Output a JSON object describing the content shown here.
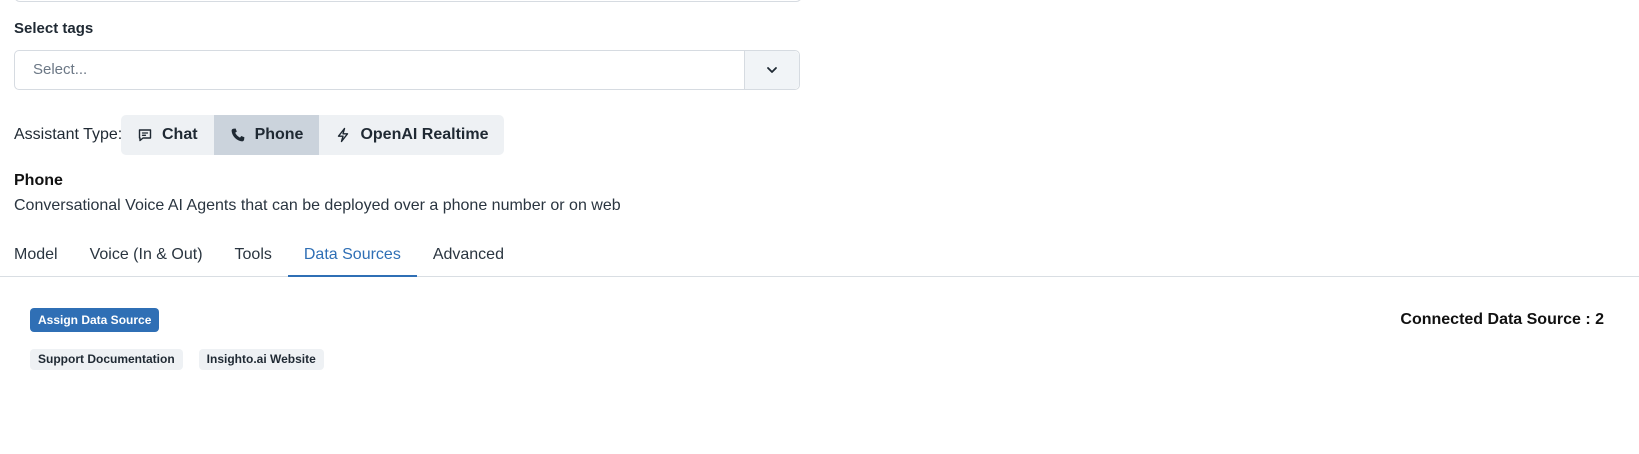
{
  "tags": {
    "label": "Select tags",
    "placeholder": "Select..."
  },
  "assistant_type": {
    "label": "Assistant Type:",
    "options": [
      {
        "label": "Chat",
        "icon": "chat-icon",
        "selected": false
      },
      {
        "label": "Phone",
        "icon": "phone-icon",
        "selected": true
      },
      {
        "label": "OpenAI Realtime",
        "icon": "lightning-icon",
        "selected": false
      }
    ],
    "title": "Phone",
    "description": "Conversational Voice AI Agents that can be deployed over a phone number or on web"
  },
  "tabs": [
    {
      "label": "Model",
      "active": false
    },
    {
      "label": "Voice (In & Out)",
      "active": false
    },
    {
      "label": "Tools",
      "active": false
    },
    {
      "label": "Data Sources",
      "active": true
    },
    {
      "label": "Advanced",
      "active": false
    }
  ],
  "data_sources": {
    "assign_label": "Assign Data Source",
    "connected_label": "Connected Data Source : 2",
    "items": [
      "Support Documentation",
      "Insighto.ai Website"
    ]
  },
  "colors": {
    "accent": "#2f6fb5",
    "selected_bg": "#cbd3dc",
    "chip_bg": "#eef1f4"
  }
}
